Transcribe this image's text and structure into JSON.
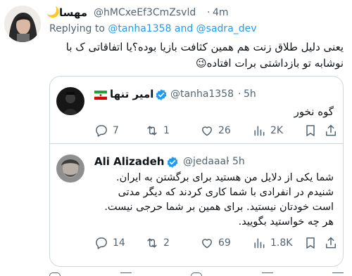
{
  "outer_tweet": {
    "display_name": "مهسا",
    "moon_glyph": "🌙",
    "handle": "@hMCxeEf3CmZsvld",
    "dot": "·",
    "time": "4m",
    "replying_prefix": "Replying to",
    "replying_user1": "@tanha1358",
    "replying_and": "and",
    "replying_user2": "@sadra_dev",
    "text_line1": "یعنی دلیل طلاق زنت هم همین کثافت بازیا بوده؟یا اتفاقاتی ک با",
    "text_line2": "نوشابه تو بازداشتی برات افتاده😉"
  },
  "quoted_tweet_1": {
    "display_name": "امیر تنها",
    "flag": "🇮🇷",
    "handle": "@tanha1358",
    "dot": "·",
    "time": "5h",
    "text": "گوه نخور",
    "actions": {
      "replies": "7",
      "retweets": "1",
      "likes": "26",
      "views": "2K"
    }
  },
  "quoted_tweet_2": {
    "display_name": "Ali Alizadeh",
    "handle": "@jedaaal",
    "dot": "·",
    "time": "5h",
    "text_lines": [
      "شما یکی از دلایل من هستید برای برگشتن به ایران.",
      "شنیدم در انفرادی با شما کاری کردند که دیگر مدتی",
      "است خودتان نیستید. برای همین بر شما حرجی نیست.",
      "هر چه خواستید بگویید."
    ],
    "actions": {
      "replies": "14",
      "retweets": "2",
      "likes": "69",
      "views": "1.8K"
    }
  },
  "colors": {
    "link": "#1d9bf0",
    "muted": "#536471",
    "border": "#cfd9de",
    "verified": "#1d9bf0"
  }
}
